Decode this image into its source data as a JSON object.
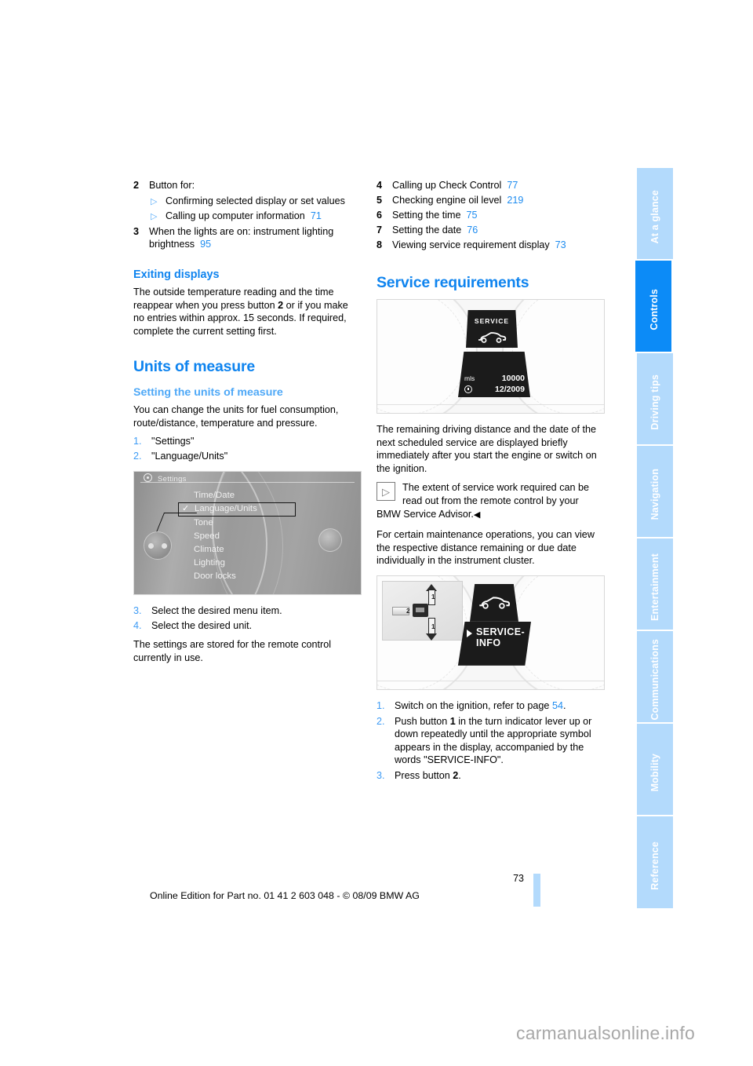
{
  "page": {
    "number": "73",
    "edition_line": "Online Edition for Part no. 01 41 2 603 048 - © 08/09 BMW AG",
    "watermark": "carmanualsonline.info"
  },
  "tabs": [
    {
      "label": "At a glance",
      "active": false
    },
    {
      "label": "Controls",
      "active": true
    },
    {
      "label": "Driving tips",
      "active": false
    },
    {
      "label": "Navigation",
      "active": false
    },
    {
      "label": "Entertainment",
      "active": false
    },
    {
      "label": "Communications",
      "active": false
    },
    {
      "label": "Mobility",
      "active": false
    },
    {
      "label": "Reference",
      "active": false
    }
  ],
  "left_column": {
    "key_items": [
      {
        "num": "2",
        "text": "Button for:"
      },
      {
        "num": "3",
        "text": "When the lights are on: instrument lighting brightness",
        "page": "95"
      }
    ],
    "key2_sub": [
      {
        "text": "Confirming selected display or set values",
        "page": ""
      },
      {
        "text": "Calling up computer information",
        "page": "71"
      }
    ],
    "exiting": {
      "heading": "Exiting displays",
      "body": "The outside temperature reading and the time reappear when you press button 2 or if you make no entries within approx. 15 seconds. If required, complete the current setting first.",
      "body_pre": "The outside temperature reading and the time reappear when you press button ",
      "body_bold": "2",
      "body_post": " or if you make no entries within approx. 15 seconds. If required, complete the current setting first."
    },
    "units": {
      "heading": "Units of measure",
      "sub_heading": "Setting the units of measure",
      "intro": "You can change the units for fuel consumption, route/distance, temperature and pressure.",
      "steps_a": [
        {
          "num": "1.",
          "text": "\"Settings\""
        },
        {
          "num": "2.",
          "text": "\"Language/Units\""
        }
      ],
      "steps_b": [
        {
          "num": "3.",
          "text": "Select the desired menu item."
        },
        {
          "num": "4.",
          "text": "Select the desired unit."
        }
      ],
      "closing": "The settings are stored for the remote control currently in use."
    },
    "idrive_figure": {
      "title": "Settings",
      "gear_icon": "gear-icon",
      "check_icon": "check-icon",
      "items": [
        "Time/Date",
        "Language/Units",
        "Tone",
        "Speed",
        "Climate",
        "Lighting",
        "Door locks"
      ],
      "selected_index": 1
    }
  },
  "right_column": {
    "key_items": [
      {
        "num": "4",
        "text": "Calling up Check Control",
        "page": "77"
      },
      {
        "num": "5",
        "text": "Checking engine oil level",
        "page": "219"
      },
      {
        "num": "6",
        "text": "Setting the time",
        "page": "75"
      },
      {
        "num": "7",
        "text": "Setting the date",
        "page": "76"
      },
      {
        "num": "8",
        "text": "Viewing service requirement display",
        "page": "73"
      }
    ],
    "service": {
      "heading": "Service requirements",
      "para1": "The remaining driving distance and the date of the next scheduled service are displayed briefly immediately after you start the engine or switch on the ignition.",
      "note": "The extent of service work required can be read out from the remote control by your BMW Service Advisor.",
      "note_end": "◀",
      "note_icon": "triangle-note-icon",
      "para2": "For certain maintenance operations, you can view the respective distance remaining or due date individually in the instrument cluster."
    },
    "service_figure": {
      "badge_label": "SERVICE",
      "car_icon": "car-icon",
      "distance_unit": "mls",
      "distance_value": "10000",
      "clock_icon": "clock-icon",
      "date_value": "12/2009"
    },
    "svcinfo_figure": {
      "car_icon": "car-icon",
      "play_icon": "play-triangle-icon",
      "text_line1": "SERVICE-",
      "text_line2": "INFO",
      "lever_num_up": "1",
      "lever_num_down": "1",
      "lever_num_press": "2"
    },
    "steps": [
      {
        "num": "1.",
        "pre": "Switch on the ignition, refer to page ",
        "page": "54",
        "post": "."
      },
      {
        "num": "2.",
        "pre": "Push button ",
        "bold": "1",
        "post": " in the turn indicator lever up or down repeatedly until the appropriate symbol appears in the display, accompanied by the words \"SERVICE-INFO\"."
      },
      {
        "num": "3.",
        "pre": "Press button ",
        "bold": "2",
        "post": "."
      }
    ]
  },
  "colors": {
    "accent_blue": "#0f84ef",
    "light_blue": "#4ea8f7",
    "tab_inactive": "#b3dafc",
    "tab_active": "#0c8bf7",
    "page_link": "#1e8cf0"
  }
}
